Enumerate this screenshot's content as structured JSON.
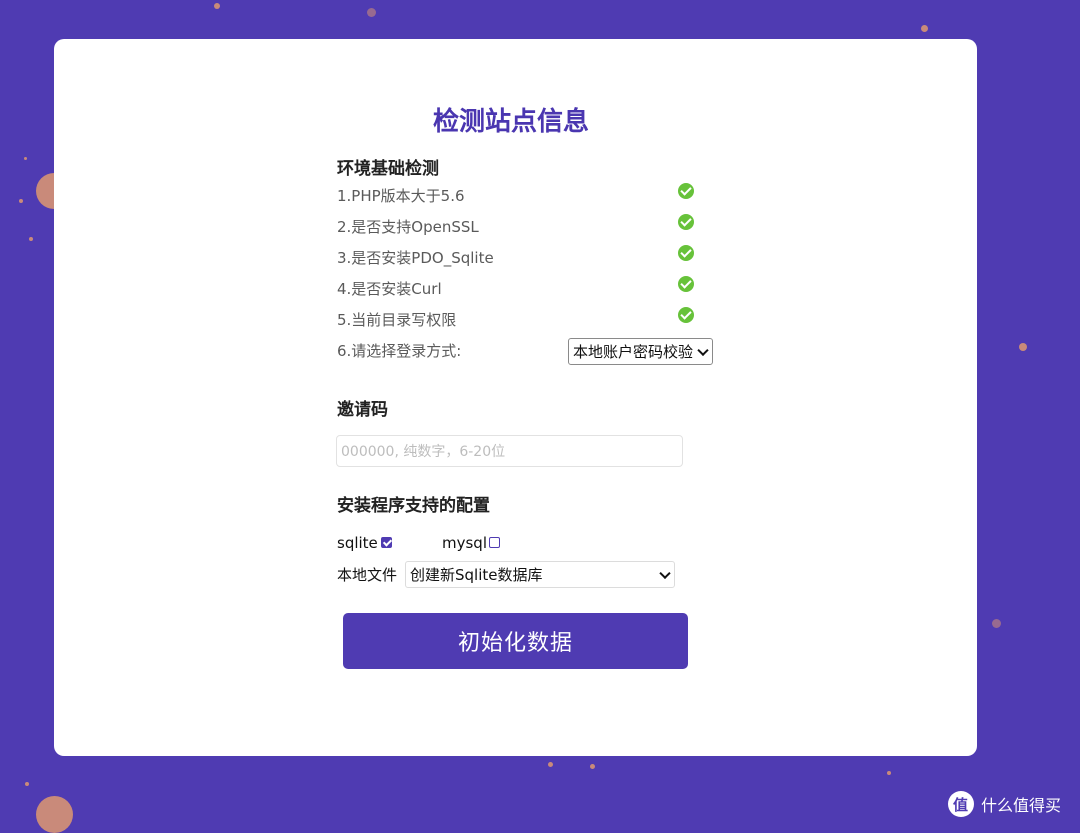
{
  "page": {
    "title": "检测站点信息",
    "env_section": "环境基础检测",
    "checks": [
      {
        "label": "1.PHP版本大于5.6",
        "status": "ok"
      },
      {
        "label": "2.是否支持OpenSSL",
        "status": "ok"
      },
      {
        "label": "3.是否安装PDO_Sqlite",
        "status": "ok"
      },
      {
        "label": "4.是否安装Curl",
        "status": "ok"
      },
      {
        "label": "5.当前目录写权限",
        "status": "ok"
      }
    ],
    "login": {
      "label": "6.请选择登录方式:",
      "selected": "本地账户密码校验"
    },
    "invite": {
      "heading": "邀请码",
      "placeholder": "000000, 纯数字，6-20位",
      "value": ""
    },
    "config": {
      "heading": "安装程序支持的配置",
      "sqlite_label": "sqlite",
      "sqlite_checked": true,
      "mysql_label": "mysql",
      "mysql_checked": false,
      "file_label": "本地文件",
      "file_selected": "创建新Sqlite数据库"
    },
    "submit_label": "初始化数据"
  },
  "watermark": {
    "text": "什么值得买"
  },
  "colors": {
    "background": "#4f3bb2",
    "accent": "#4a36b0",
    "check_ok": "#67c23a"
  }
}
